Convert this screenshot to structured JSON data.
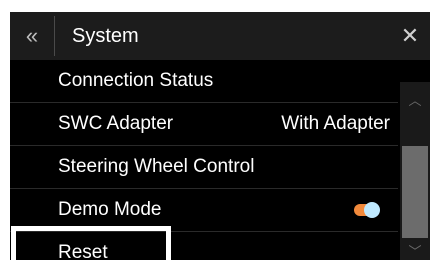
{
  "header": {
    "back_icon": "«",
    "title": "System",
    "close_icon": "✕"
  },
  "items": [
    {
      "label": "Connection Status",
      "value": ""
    },
    {
      "label": "SWC Adapter",
      "value": "With Adapter"
    },
    {
      "label": "Steering Wheel Control",
      "value": ""
    },
    {
      "label": "Demo Mode",
      "toggle_on": true
    },
    {
      "label": "Reset",
      "value": ""
    }
  ],
  "scrollbar": {
    "up_icon": "︿",
    "down_icon": "﹀"
  },
  "colors": {
    "background": "#000000",
    "header": "#1c1c1c",
    "toggle_track": "#f28a3c",
    "toggle_knob": "#bfe9ff"
  }
}
